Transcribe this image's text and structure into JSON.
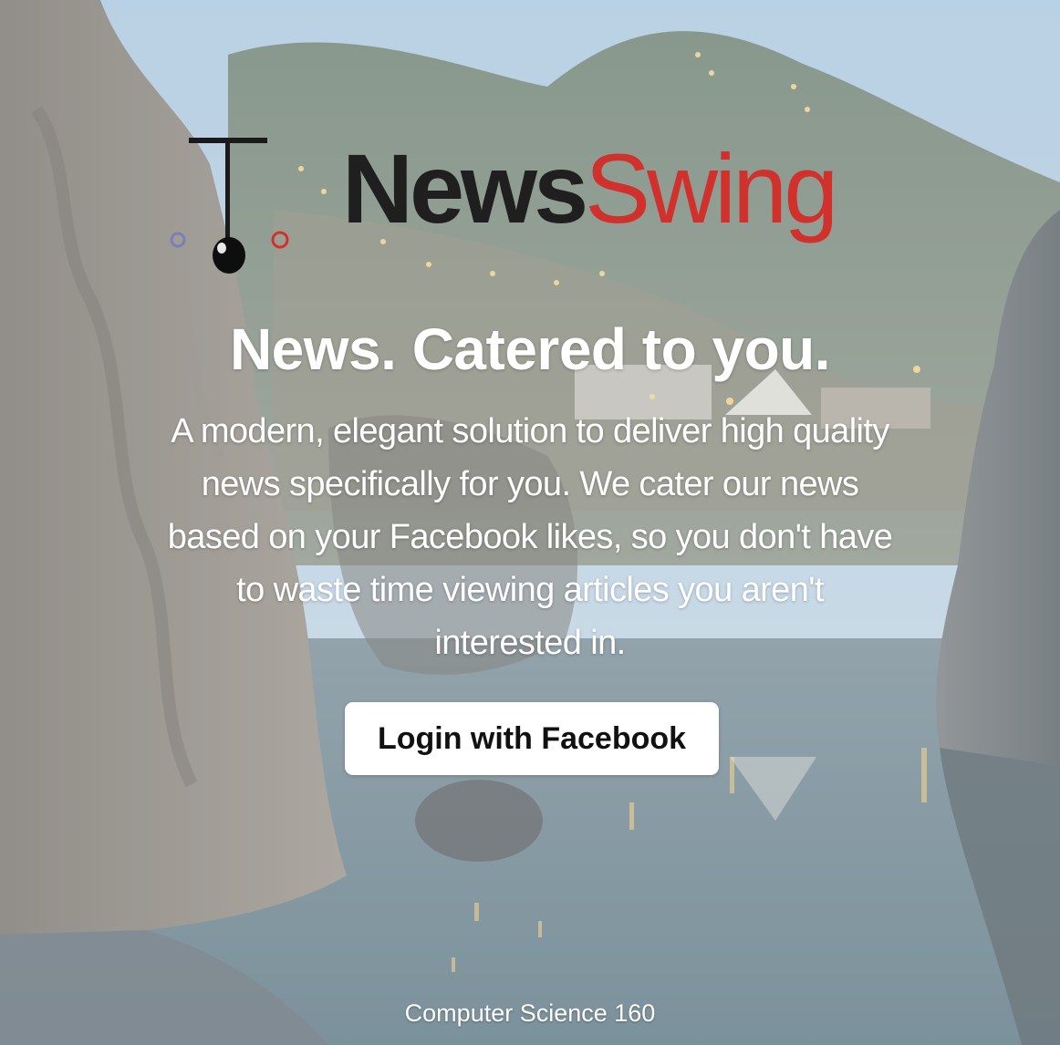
{
  "brand": {
    "name_part1": "News",
    "name_part2": "Swing",
    "color_dark": "#1f1f1f",
    "color_red": "#d0312d",
    "icon": "pendulum-icon"
  },
  "hero": {
    "tagline": "News. Catered to you.",
    "description": "A modern, elegant solution to deliver high quality news specifically for you. We cater our news based on your Facebook likes, so you don't have to waste time viewing articles you aren't interested in."
  },
  "login": {
    "label": "Login with Facebook"
  },
  "footer": {
    "text": "Computer Science 160"
  },
  "background": {
    "description_icon": "coastal-night-landscape-image"
  }
}
